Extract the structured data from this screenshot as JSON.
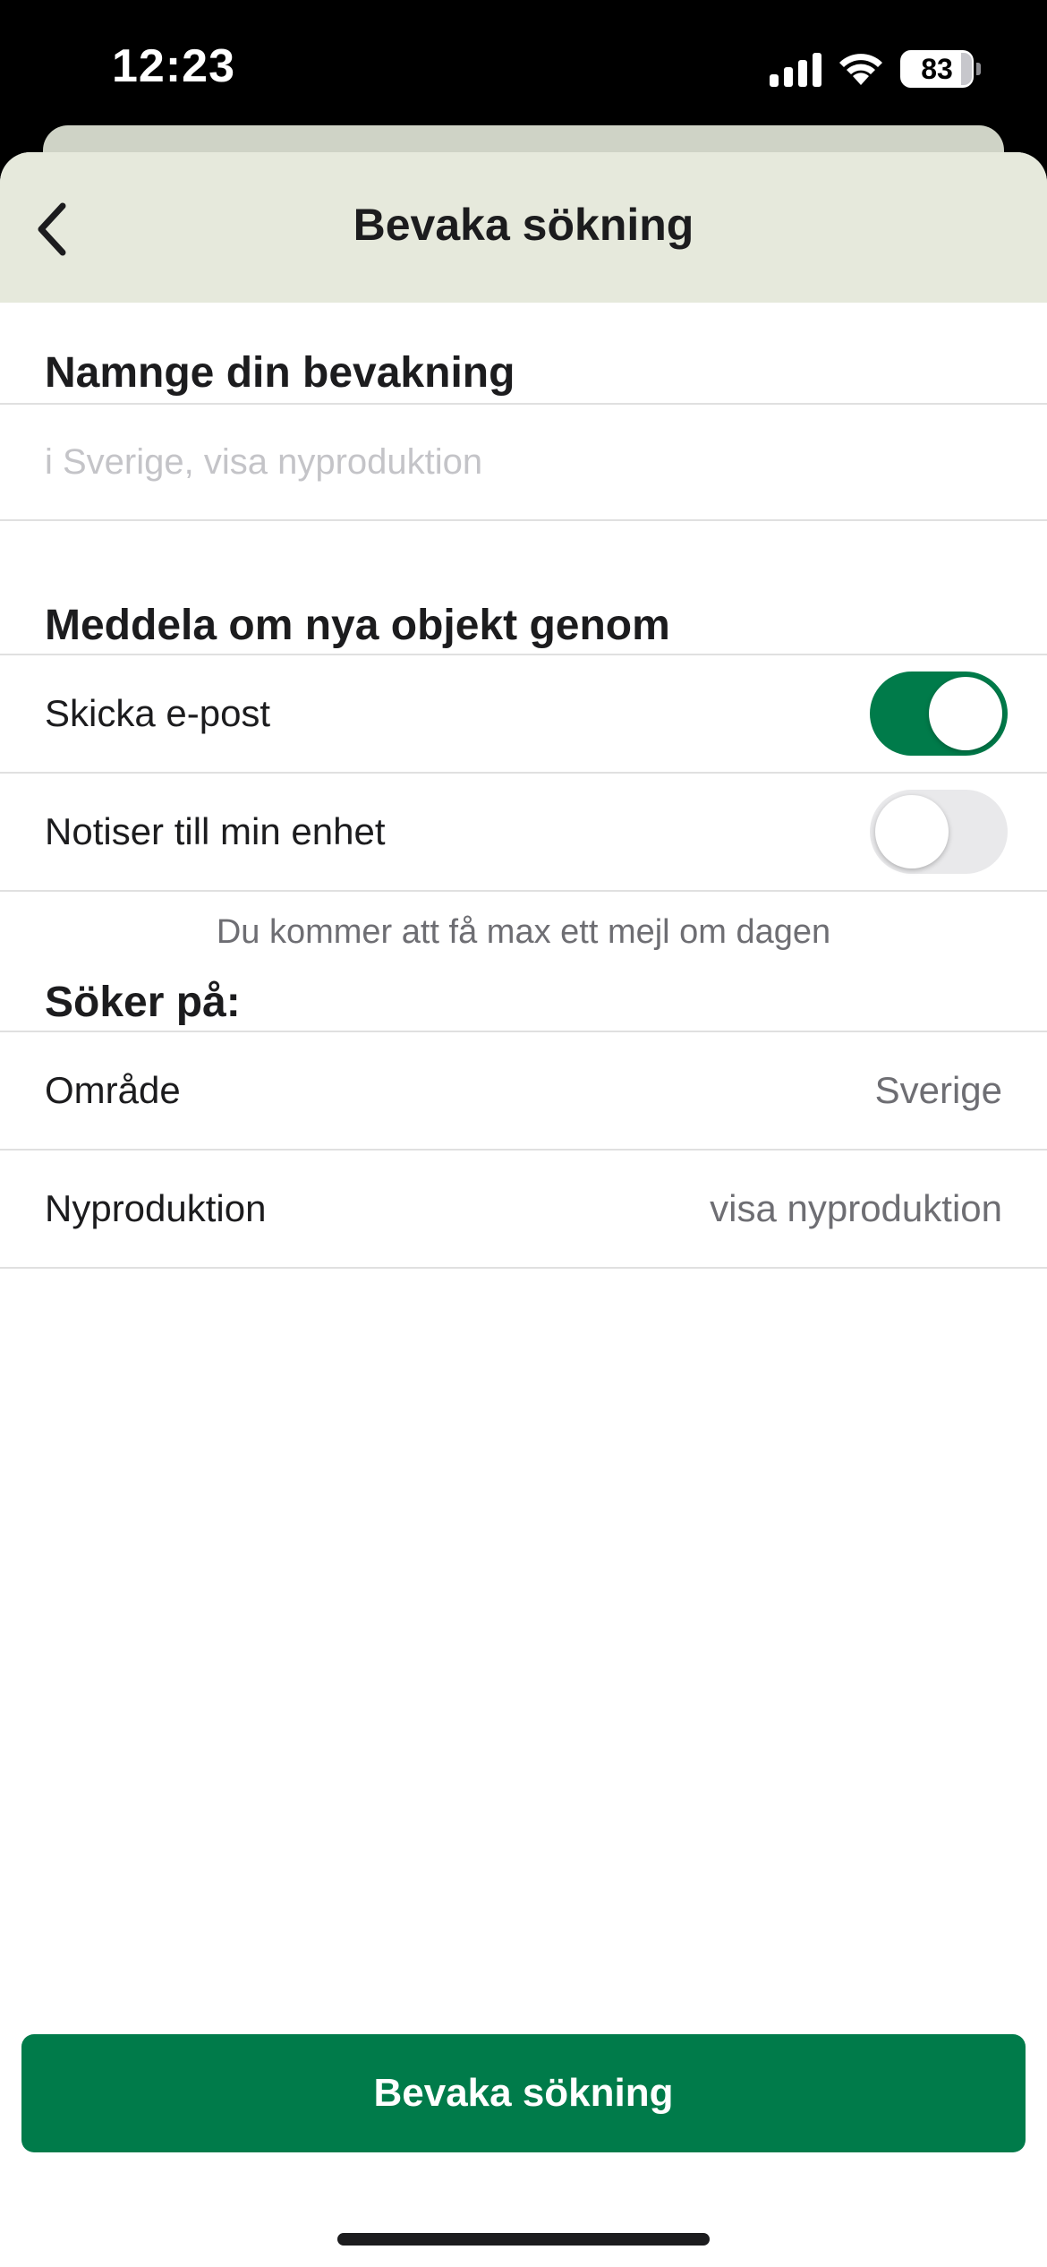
{
  "status_bar": {
    "time": "12:23",
    "battery": "83"
  },
  "header": {
    "title": "Bevaka sökning",
    "back_icon": "chevron-left-icon"
  },
  "name_section": {
    "title": "Namnge din bevakning",
    "input_value": "",
    "input_placeholder": "i Sverige, visa nyproduktion"
  },
  "notify_section": {
    "title": "Meddela om nya objekt genom",
    "options": [
      {
        "label": "Skicka e-post",
        "enabled": true
      },
      {
        "label": "Notiser till min enhet",
        "enabled": false
      }
    ],
    "helper": "Du kommer att få max ett mejl om dagen"
  },
  "search_section": {
    "title": "Söker på:",
    "rows": [
      {
        "label": "Område",
        "value": "Sverige"
      },
      {
        "label": "Nyproduktion",
        "value": "visa nyproduktion"
      }
    ]
  },
  "footer": {
    "button_label": "Bevaka sökning"
  },
  "colors": {
    "accent": "#007b4a",
    "header_bg": "#e6e9dc"
  }
}
